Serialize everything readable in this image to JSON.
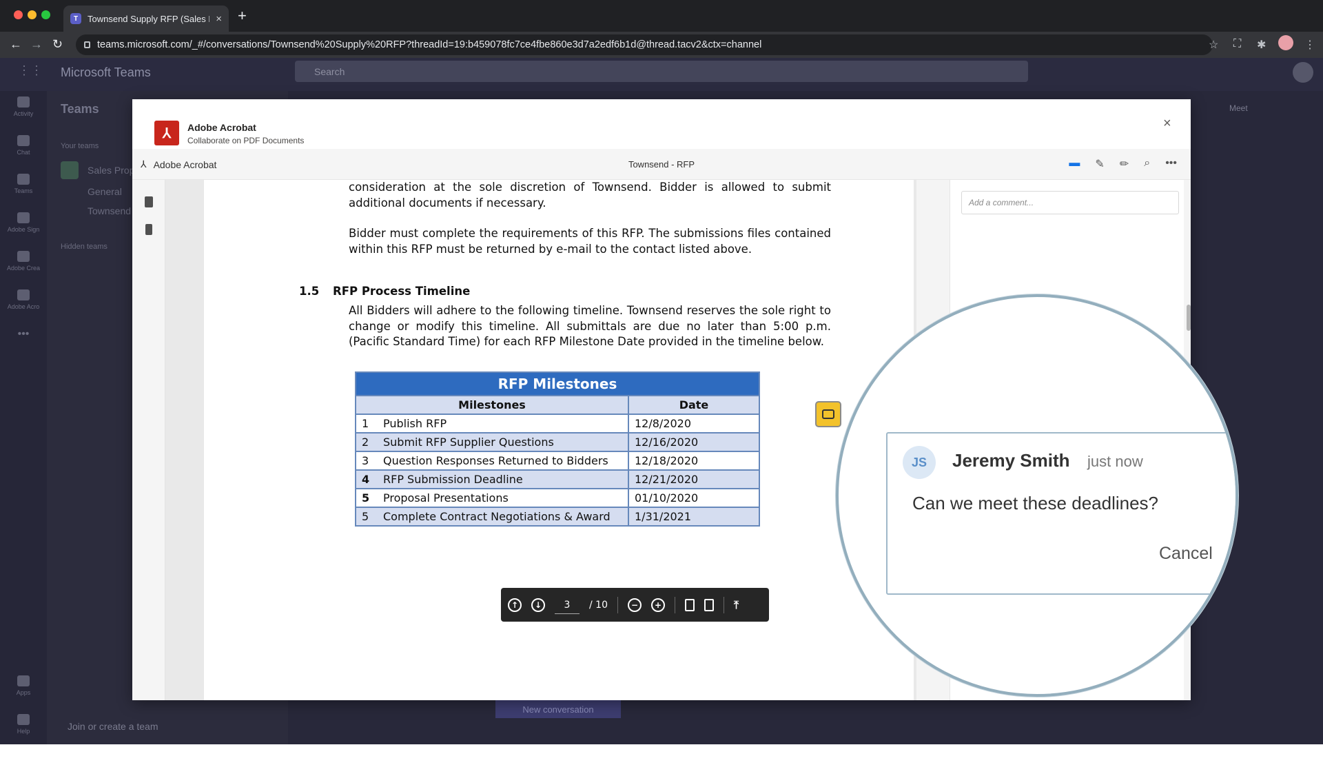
{
  "browser": {
    "tab_title": "Townsend Supply RFP (Sales P",
    "tab_close": "×",
    "new_tab": "+",
    "url": "teams.microsoft.com/_#/conversations/Townsend%20Supply%20RFP?threadId=19:b459078fc7ce4fbe860e3d7a2edf6b1d@thread.tacv2&ctx=channel"
  },
  "teams": {
    "app_title": "Microsoft Teams",
    "search_placeholder": "Search",
    "rail": [
      "Activity",
      "Chat",
      "Teams",
      "Adobe Sign",
      "Adobe Crea",
      "Adobe Acro"
    ],
    "rail_bottom": [
      "Apps",
      "Help"
    ],
    "pane_title": "Teams",
    "your_teams": "Your teams",
    "team_name": "Sales Prop",
    "channels": [
      "General",
      "Townsend"
    ],
    "hidden_teams": "Hidden teams",
    "join": "Join or create a team",
    "new_conversation": "New conversation",
    "meet": "Meet"
  },
  "modal": {
    "title": "Adobe Acrobat",
    "subtitle": "Collaborate on PDF Documents",
    "close": "×",
    "app_label": "Adobe Acrobat",
    "document_title": "Townsend - RFP"
  },
  "document": {
    "para1": "consideration at the sole discretion of Townsend.  Bidder is allowed to submit additional documents if necessary.",
    "para2": "Bidder must complete the requirements of this RFP. The submissions files contained within this RFP must be returned by e-mail to the contact listed above.",
    "section_number": "1.5",
    "section_title": "RFP Process Timeline",
    "para3": "All Bidders will adhere to the following timeline. Townsend reserves the sole right to change or modify this timeline. All submittals are due no later than 5:00 p.m. (Pacific Standard Time) for each RFP Milestone Date provided in the timeline below.",
    "table": {
      "caption": "RFP Milestones",
      "col_milestones": "Milestones",
      "col_date": "Date",
      "rows": [
        {
          "num": "1",
          "name": "Publish RFP",
          "date": "12/8/2020"
        },
        {
          "num": "2",
          "name": "Submit RFP Supplier Questions",
          "date": "12/16/2020"
        },
        {
          "num": "3",
          "name": "Question Responses Returned to Bidders",
          "date": "12/18/2020"
        },
        {
          "num": "4",
          "name": "RFP Submission Deadline",
          "date": "12/21/2020"
        },
        {
          "num": "5",
          "name": "Proposal Presentations",
          "date": "01/10/2020"
        },
        {
          "num": "5",
          "name": "Complete Contract Negotiations & Award",
          "date": "1/31/2021"
        }
      ]
    }
  },
  "pager": {
    "current_page": "3",
    "total": "/ 10"
  },
  "comments": {
    "placeholder": "Add a comment...",
    "zoom": {
      "initials": "JS",
      "author": "Jeremy Smith",
      "time": "just now",
      "message": "Can we meet these deadlines?",
      "cancel": "Cancel"
    }
  }
}
